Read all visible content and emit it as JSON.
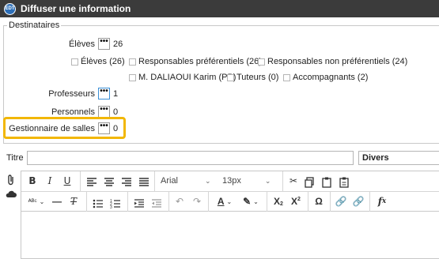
{
  "window": {
    "title": "Diffuser une information",
    "app_icon_text": "EDT"
  },
  "destinataires": {
    "legend": "Destinataires",
    "eleves": {
      "label": "Élèves",
      "count": "26"
    },
    "checkboxes": [
      {
        "label": "Élèves (26)"
      },
      {
        "label": "Responsables préférentiels (26)"
      },
      {
        "label": "Responsables non préférentiels (24)"
      },
      {
        "label": "M. DALIAOUI Karim (PP)"
      },
      {
        "label": "Tuteurs (0)"
      },
      {
        "label": "Accompagnants (2)"
      }
    ],
    "professeurs": {
      "label": "Professeurs",
      "count": "1"
    },
    "personnels": {
      "label": "Personnels",
      "count": "0"
    },
    "gestionnaire": {
      "label": "Gestionnaire de salles",
      "count": "0"
    },
    "dots_label": "•••"
  },
  "titre": {
    "label": "Titre",
    "value": ""
  },
  "category": {
    "value": "Divers"
  },
  "toolbar": {
    "font_family": "Arial",
    "font_size": "13px"
  },
  "colors": {
    "titlebar": "#3b3b3b",
    "highlight": "#f2b705",
    "focus": "#3a8fd6"
  }
}
